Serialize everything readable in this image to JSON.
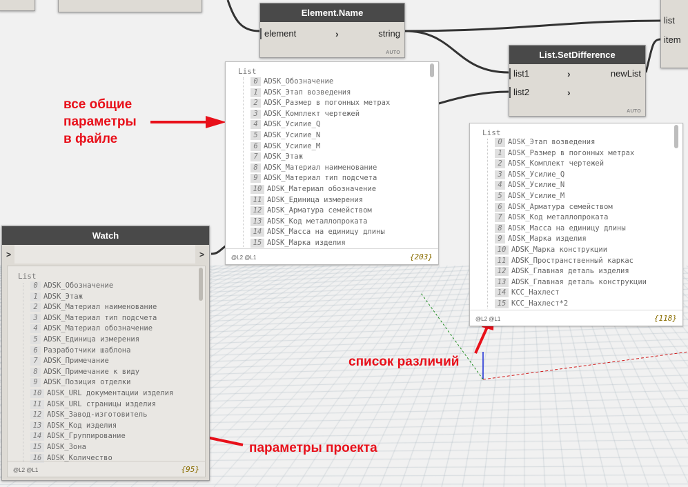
{
  "element_name_node": {
    "title": "Element.Name",
    "input": "element",
    "output": "string",
    "mode": "AUTO"
  },
  "set_difference_node": {
    "title": "List.SetDifference",
    "input1": "list1",
    "input2": "list2",
    "output": "newList",
    "mode": "AUTO"
  },
  "right_partial_node": {
    "port1": "list",
    "port2": "item"
  },
  "all_params_preview": {
    "title": "List",
    "items": [
      "ADSK_Обозначение",
      "ADSK_Этап возведения",
      "ADSK_Размер в погонных метрах",
      "ADSK_Комплект чертежей",
      "ADSK_Усилие_Q",
      "ADSK_Усилие_N",
      "ADSK_Усилие_M",
      "ADSK_Этаж",
      "ADSK_Материал наименование",
      "ADSK_Материал тип подсчета",
      "ADSK_Материал обозначение",
      "ADSK_Единица измерения",
      "ADSK_Арматура семейством",
      "ADSK_Код металлопроката",
      "ADSK_Масса на единицу длины",
      "ADSK_Марка изделия"
    ],
    "levels": "@L2 @L1",
    "count": "{203}"
  },
  "difference_preview": {
    "title": "List",
    "items": [
      "ADSK_Этап возведения",
      "ADSK_Размер в погонных метрах",
      "ADSK_Комплект чертежей",
      "ADSK_Усилие_Q",
      "ADSK_Усилие_N",
      "ADSK_Усилие_M",
      "ADSK_Арматура семейством",
      "ADSK_Код металлопроката",
      "ADSK_Масса на единицу длины",
      "ADSK_Марка изделия",
      "ADSK_Марка конструкции",
      "ADSK_Пространственный каркас",
      "ADSK_Главная деталь изделия",
      "ADSK_Главная деталь конструкции",
      "КСС_Нахлест",
      "КСС_Нахлест*2"
    ],
    "levels": "@L2 @L1",
    "count": "{118}"
  },
  "watch_node": {
    "title": "Watch",
    "list_title": "List",
    "items": [
      "ADSK_Обозначение",
      "ADSK_Этаж",
      "ADSK_Материал наименование",
      "ADSK_Материал тип подсчета",
      "ADSK_Материал обозначение",
      "ADSK_Единица измерения",
      "Разработчики шаблона",
      "ADSK_Примечание",
      "ADSK_Примечание к виду",
      "ADSK_Позиция отделки",
      "ADSK_URL документации изделия",
      "ADSK_URL страницы изделия",
      "ADSK_Завод-изготовитель",
      "ADSK_Код изделия",
      "ADSK_Группирование",
      "ADSK_Зона",
      "ADSK_Количество"
    ],
    "levels": "@L2 @L1",
    "count": "{95}"
  },
  "annotations": {
    "all_params_line1": "все общие",
    "all_params_line2": "параметры",
    "all_params_line3": "в файле",
    "difference_label": "список различий",
    "project_params_label": "параметры проекта"
  },
  "colors": {
    "annotation": "#e8101a",
    "node_header": "#494949",
    "node_body": "#dedbd5",
    "wire": "#333333"
  }
}
